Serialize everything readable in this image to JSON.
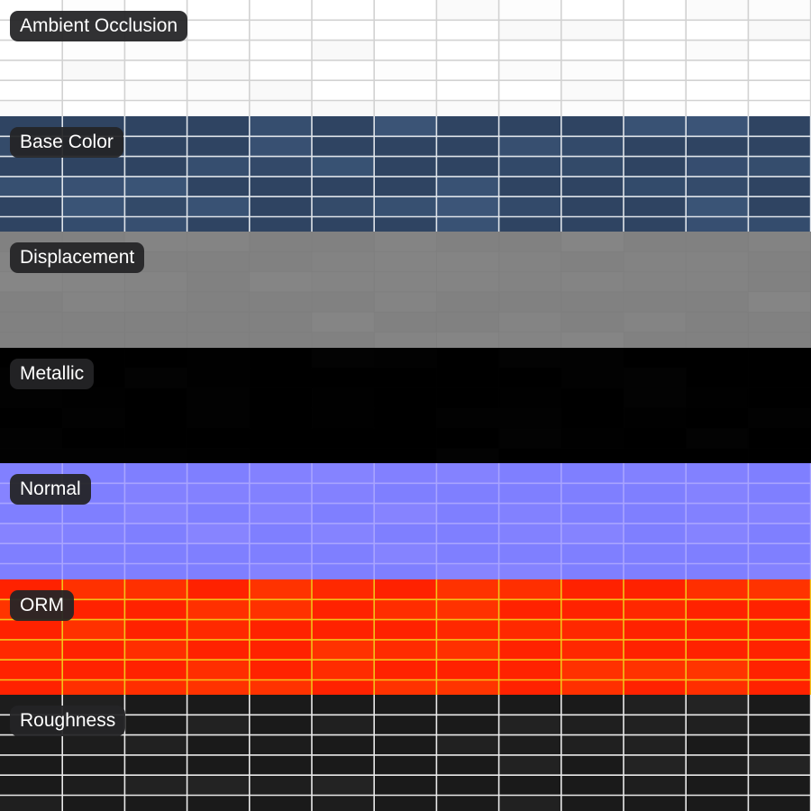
{
  "maps": [
    {
      "label": "Ambient Occlusion",
      "base": "#ffffff",
      "base_alt": "#f7f7f7",
      "grout": "#d2d2d2",
      "gridlines": true
    },
    {
      "label": "Base Color",
      "base": "#2f4462",
      "base_alt": "#3f5a7e",
      "grout": "#dfe4ea",
      "gridlines": true
    },
    {
      "label": "Displacement",
      "base": "#818181",
      "base_alt": "#878787",
      "grout": "#7a7a7a",
      "gridlines": false
    },
    {
      "label": "Metallic",
      "base": "#000000",
      "base_alt": "#040404",
      "grout": "#050505",
      "gridlines": false
    },
    {
      "label": "Normal",
      "base": "#7f7fff",
      "base_alt": "#8a86ff",
      "grout": "#a8a4ff",
      "gridlines": true
    },
    {
      "label": "ORM",
      "base": "#ff2200",
      "base_alt": "#ff3a00",
      "grout": "#f2c21a",
      "gridlines": true
    },
    {
      "label": "Roughness",
      "base": "#1a1a1a",
      "base_alt": "#262626",
      "grout": "#e9e9e9",
      "gridlines": true
    }
  ]
}
